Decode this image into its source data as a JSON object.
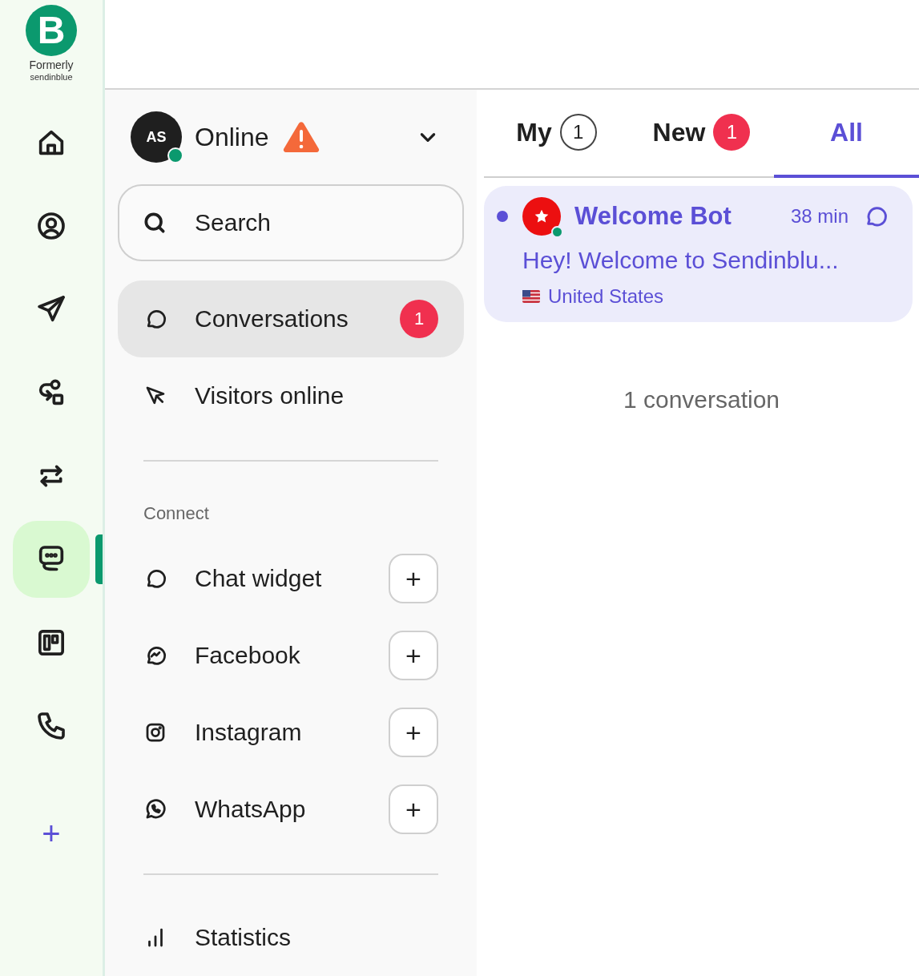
{
  "brand": {
    "logo_letter": "B",
    "caption_1": "Formerly",
    "caption_2": "sendinblue"
  },
  "rail": {
    "items": [
      {
        "kind": "home",
        "selected": false
      },
      {
        "kind": "contact",
        "selected": false
      },
      {
        "kind": "send",
        "selected": false
      },
      {
        "kind": "automation",
        "selected": false
      },
      {
        "kind": "transfer",
        "selected": false
      },
      {
        "kind": "chat",
        "selected": true
      },
      {
        "kind": "board",
        "selected": false
      },
      {
        "kind": "phone",
        "selected": false
      }
    ],
    "add": "+"
  },
  "status": {
    "initials": "AS",
    "label": "Online",
    "online": true,
    "warning": true
  },
  "search": {
    "placeholder": "Search"
  },
  "nav": [
    {
      "kind": "chat",
      "label": "Conversations",
      "badge": "1",
      "selected": true
    },
    {
      "kind": "cursor",
      "label": "Visitors online",
      "selected": false
    }
  ],
  "connect": {
    "heading": "Connect",
    "channels": [
      {
        "kind": "chat",
        "label": "Chat widget",
        "action": "+"
      },
      {
        "kind": "messenger",
        "label": "Facebook",
        "action": "+"
      },
      {
        "kind": "instagram",
        "label": "Instagram",
        "action": "+"
      },
      {
        "kind": "whatsapp",
        "label": "WhatsApp",
        "action": "+"
      }
    ]
  },
  "footer_nav": [
    {
      "kind": "stats",
      "label": "Statistics"
    }
  ],
  "tabs": [
    {
      "label": "My",
      "count": "1",
      "kind": "outline",
      "selected": false
    },
    {
      "label": "New",
      "count": "1",
      "kind": "alert",
      "selected": false
    },
    {
      "label": "All",
      "selected": true
    }
  ],
  "conversations": [
    {
      "name": "Welcome Bot",
      "time": "38 min",
      "preview": "Hey! Welcome to Sendinblu...",
      "country": "United States",
      "unread": true,
      "online": true,
      "selected": true
    }
  ],
  "summary": "1 conversation"
}
